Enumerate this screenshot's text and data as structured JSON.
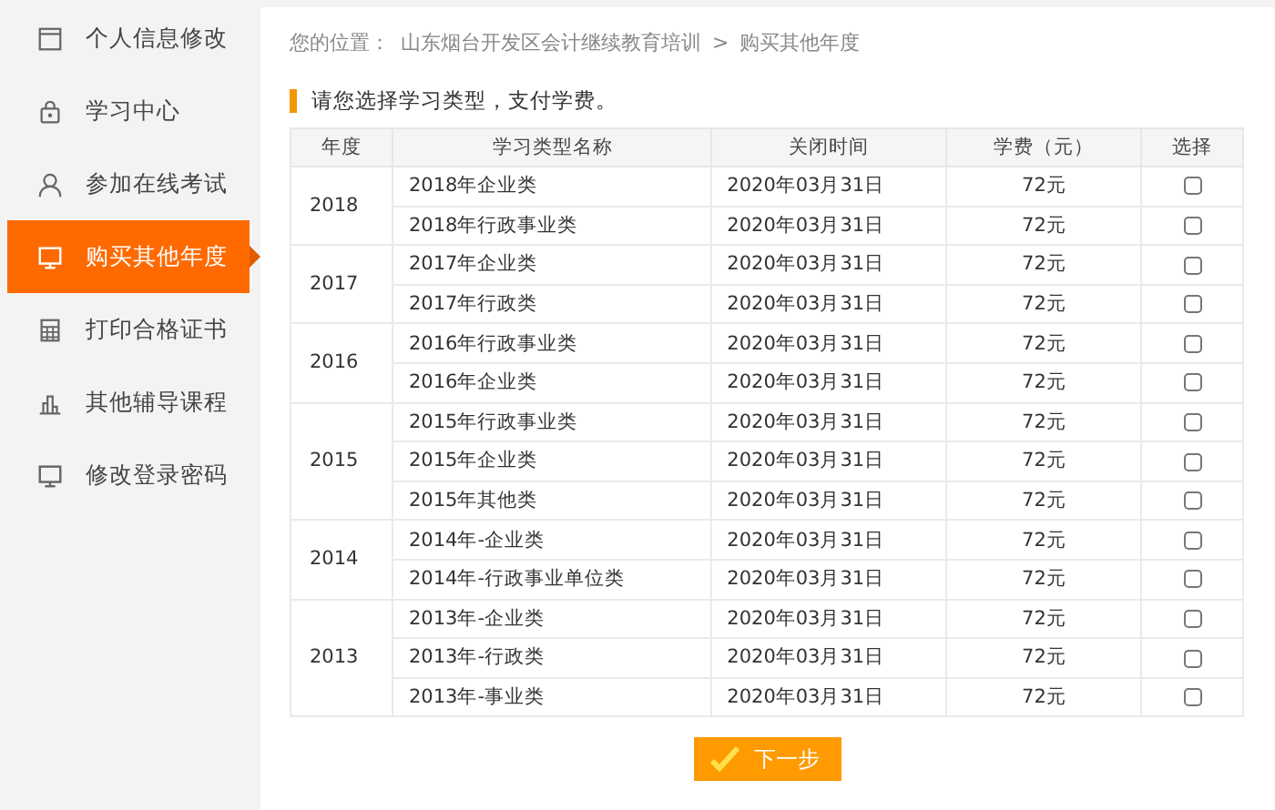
{
  "sidebar": {
    "items": [
      {
        "label": "个人信息修改",
        "selected": false
      },
      {
        "label": "学习中心",
        "selected": false
      },
      {
        "label": "参加在线考试",
        "selected": false
      },
      {
        "label": "购买其他年度",
        "selected": true
      },
      {
        "label": "打印合格证书",
        "selected": false
      },
      {
        "label": "其他辅导课程",
        "selected": false
      },
      {
        "label": "修改登录密码",
        "selected": false
      }
    ]
  },
  "breadcrumb": {
    "label": "您的位置：",
    "items": [
      "山东烟台开发区会计继续教育培训",
      "购买其他年度"
    ],
    "separator": ">"
  },
  "notice": "请您选择学习类型，支付学费。",
  "table": {
    "columns": [
      "年度",
      "学习类型名称",
      "关闭时间",
      "学费（元）",
      "选择"
    ],
    "groups": [
      {
        "year": "2018",
        "rows": [
          {
            "name": "2018年企业类",
            "closing": "2020年03月31日",
            "fee": "72元",
            "checked": false
          },
          {
            "name": "2018年行政事业类",
            "closing": "2020年03月31日",
            "fee": "72元",
            "checked": false
          }
        ]
      },
      {
        "year": "2017",
        "rows": [
          {
            "name": "2017年企业类",
            "closing": "2020年03月31日",
            "fee": "72元",
            "checked": false
          },
          {
            "name": "2017年行政类",
            "closing": "2020年03月31日",
            "fee": "72元",
            "checked": false
          }
        ]
      },
      {
        "year": "2016",
        "rows": [
          {
            "name": "2016年行政事业类",
            "closing": "2020年03月31日",
            "fee": "72元",
            "checked": false
          },
          {
            "name": "2016年企业类",
            "closing": "2020年03月31日",
            "fee": "72元",
            "checked": false
          }
        ]
      },
      {
        "year": "2015",
        "rows": [
          {
            "name": "2015年行政事业类",
            "closing": "2020年03月31日",
            "fee": "72元",
            "checked": false
          },
          {
            "name": "2015年企业类",
            "closing": "2020年03月31日",
            "fee": "72元",
            "checked": false
          },
          {
            "name": "2015年其他类",
            "closing": "2020年03月31日",
            "fee": "72元",
            "checked": false
          }
        ]
      },
      {
        "year": "2014",
        "rows": [
          {
            "name": "2014年-企业类",
            "closing": "2020年03月31日",
            "fee": "72元",
            "checked": false
          },
          {
            "name": "2014年-行政事业单位类",
            "closing": "2020年03月31日",
            "fee": "72元",
            "checked": false
          }
        ]
      },
      {
        "year": "2013",
        "rows": [
          {
            "name": "2013年-企业类",
            "closing": "2020年03月31日",
            "fee": "72元",
            "checked": false
          },
          {
            "name": "2013年-行政类",
            "closing": "2020年03月31日",
            "fee": "72元",
            "checked": false
          },
          {
            "name": "2013年-事业类",
            "closing": "2020年03月31日",
            "fee": "72元",
            "checked": false
          }
        ]
      }
    ]
  },
  "next_button": "下一步"
}
